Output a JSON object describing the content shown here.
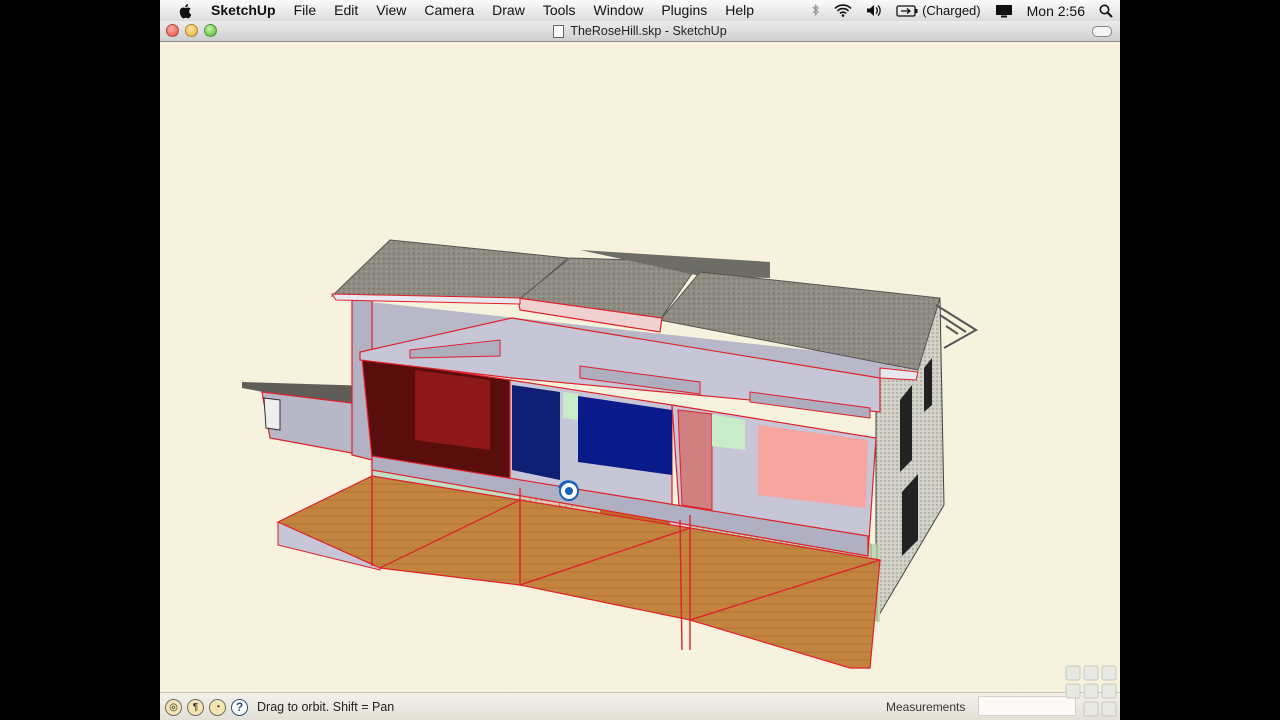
{
  "menubar": {
    "app_name": "SketchUp",
    "items": [
      "File",
      "Edit",
      "View",
      "Camera",
      "Draw",
      "Tools",
      "Window",
      "Plugins",
      "Help"
    ],
    "battery_status": "(Charged)",
    "clock": "Mon 2:56"
  },
  "window": {
    "title": "TheRoseHill.skp - SketchUp"
  },
  "statusbar": {
    "hint": "Drag to orbit.  Shift = Pan",
    "measurements_label": "Measurements",
    "help_glyph": "?"
  },
  "icons": [
    "apple-icon",
    "bluetooth-icon",
    "wifi-icon",
    "volume-icon",
    "battery-icon",
    "display-icon",
    "spotlight-icon",
    "orbit-cursor-icon",
    "geo-location-icon",
    "credits-icon",
    "model-info-icon",
    "help-icon",
    "resize-grip-icon"
  ],
  "colors": {
    "sky": "#f7f2dd",
    "section_edge": "#e0202a",
    "roof": "#8e8b83",
    "floor": "#c2843e",
    "wall_red": "#6a1212",
    "wall_blue": "#0e1f74",
    "wall_pink": "#f6a5a0",
    "slab": "#c6c6d6"
  }
}
